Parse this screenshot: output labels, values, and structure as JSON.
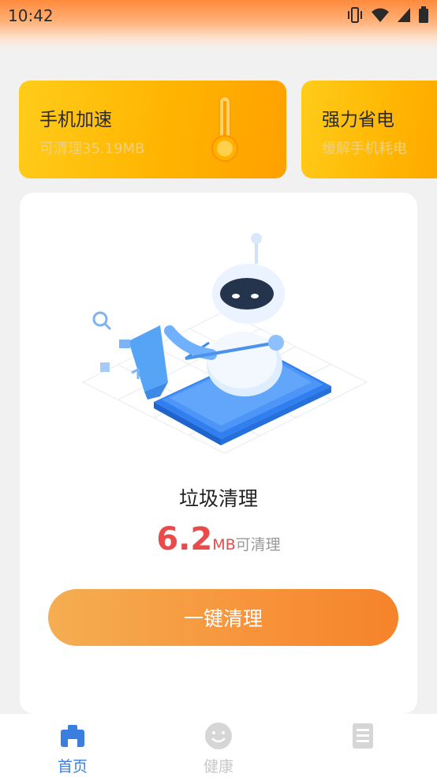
{
  "status_bar": {
    "time": "10:42",
    "icons": [
      "vibrate-icon",
      "wifi-icon",
      "signal-icon",
      "battery-icon"
    ]
  },
  "feature_cards": [
    {
      "title": "手机加速",
      "subtitle_prefix": "可清理",
      "subtitle_value": "35.19MB",
      "icon": "thermometer-icon"
    },
    {
      "title": "强力省电",
      "subtitle": "缓解手机耗电"
    }
  ],
  "clean_card": {
    "illustration": "robot-sweeping-phone-illustration",
    "title": "垃圾清理",
    "size_value": "6.2",
    "size_unit": "MB",
    "size_suffix": "可清理",
    "button_label": "一键清理"
  },
  "tabs": [
    {
      "label": "首页",
      "icon": "home-icon",
      "active": true
    },
    {
      "label": "健康",
      "icon": "smiley-icon",
      "active": false
    },
    {
      "label": "",
      "icon": "document-icon",
      "active": false
    }
  ],
  "colors": {
    "accent": "#3a7fe0",
    "size_red": "#e94b4b",
    "button_orange": "#f7933a",
    "card_yellow": "#ffb400"
  }
}
